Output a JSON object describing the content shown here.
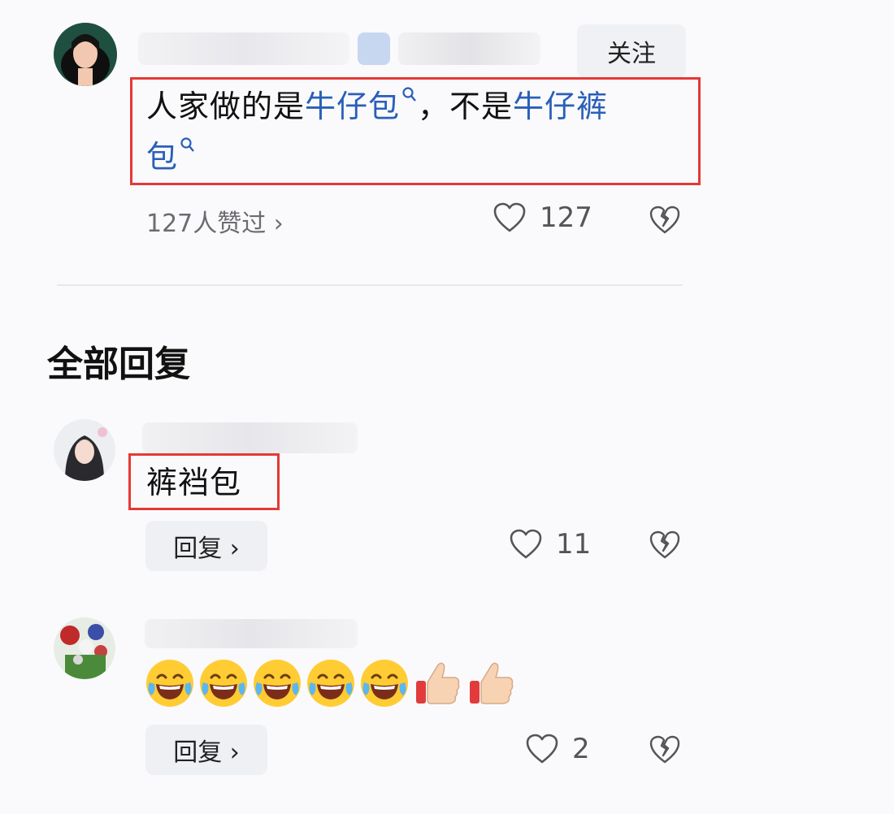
{
  "top_comment": {
    "follow_label": "关注",
    "text_line1_parts": [
      "人家做的是",
      "牛仔包",
      "，不是",
      "牛仔裤"
    ],
    "text_line2_parts": [
      "包"
    ],
    "liked_summary": "127人赞过 ›",
    "like_count": "127"
  },
  "section_title": "全部回复",
  "replies": [
    {
      "text": "裤裆包",
      "reply_label": "回复 ›",
      "like_count": "11"
    },
    {
      "emojis": [
        "laughing-crying-emoji",
        "laughing-crying-emoji",
        "laughing-crying-emoji",
        "laughing-crying-emoji",
        "laughing-crying-emoji",
        "thumbs-up-emoji",
        "thumbs-up-emoji"
      ],
      "reply_label": "回复 ›",
      "like_count": "2"
    }
  ],
  "colors": {
    "link": "#2a5fb8",
    "highlight_box": "#e53935",
    "background": "#fafafc"
  }
}
